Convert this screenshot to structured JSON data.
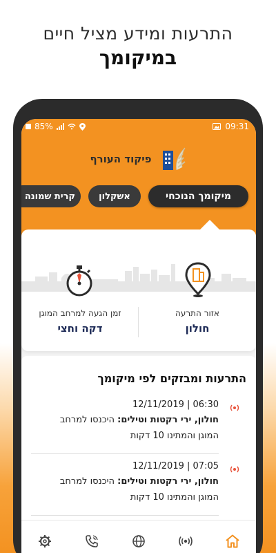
{
  "headline": {
    "line1": "התרעות ומידע מציל חיים",
    "line2": "במיקומך"
  },
  "status_bar": {
    "battery": "85%",
    "time": "09:31"
  },
  "app": {
    "name": "פיקוד העורף",
    "logo_icon": "home-front-command-logo"
  },
  "chips": [
    {
      "label": "מיקומך הנוכחי",
      "active": true
    },
    {
      "label": "אשקלון",
      "active": false
    },
    {
      "label": "קרית שמונה",
      "active": false
    }
  ],
  "location_card": {
    "area_label": "אזור התרעה",
    "area_value": "חולון",
    "time_label": "זמן הגעה למרחב המוגן",
    "time_value": "דקה וחצי",
    "area_icon": "location-pin-building-icon",
    "time_icon": "stopwatch-icon"
  },
  "alerts_section": {
    "title": "התרעות ומבזקים לפי מיקומך",
    "items": [
      {
        "datetime": "06:30 | 12/11/2019",
        "headline": "חולון, ירי רקטות וטילים:",
        "text": "היכנסו למרחב המוגן והמתינו 10 דקות",
        "icon": "alert-broadcast-icon"
      },
      {
        "datetime": "07:05 | 12/11/2019",
        "headline": "חולון, ירי רקטות וטילים:",
        "text": "היכנסו למרחב המוגן והמתינו 10 דקות",
        "icon": "alert-broadcast-icon"
      }
    ]
  },
  "bottom_nav": [
    {
      "name": "settings",
      "icon": "gear-icon"
    },
    {
      "name": "contact",
      "icon": "phone-icon"
    },
    {
      "name": "web",
      "icon": "globe-icon"
    },
    {
      "name": "alerts",
      "icon": "broadcast-icon"
    },
    {
      "name": "home",
      "icon": "home-icon",
      "active": true
    }
  ],
  "colors": {
    "brand_orange": "#f39221",
    "dark": "#2c2c2c",
    "navy": "#1d2a56",
    "alert_red": "#e8523a"
  }
}
